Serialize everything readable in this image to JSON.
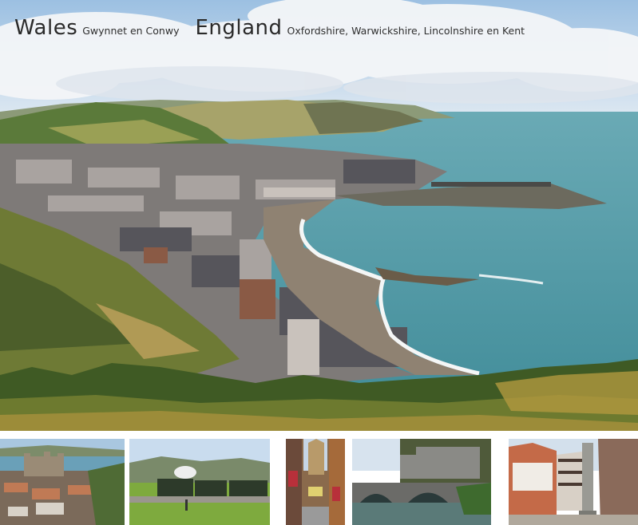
{
  "header": {
    "wales": "Wales",
    "wales_regions": "Gwynnet en Conwy",
    "england": "England",
    "england_regions": "Oxfordshire, Warwickshire, Lincolnshire en Kent"
  },
  "photos": {
    "hero": "coastal-town-panorama",
    "thumbnails": [
      "castle-town",
      "steam-train",
      "shopping-street",
      "stone-bridge",
      "market-square-cross"
    ]
  },
  "colors": {
    "sea": "#4f9aa6",
    "sky": "#b9d3ea",
    "grass": "#7c8a2a",
    "roof": "#5c5b60",
    "text": "#2a2a2a"
  }
}
